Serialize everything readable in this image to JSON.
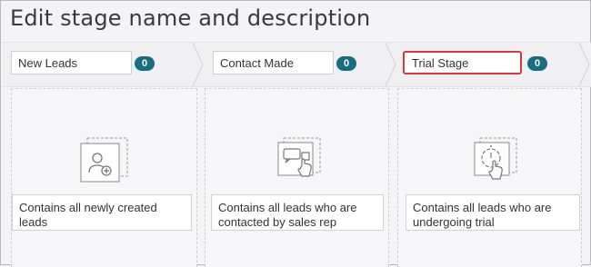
{
  "page": {
    "title": "Edit stage name and description"
  },
  "stages": [
    {
      "name": "New Leads",
      "count": "0",
      "description": "Contains all newly created leads",
      "icon": "add-user-icon"
    },
    {
      "name": "Contact Made",
      "count": "0",
      "description": "Contains all leads who are contacted by sales rep",
      "icon": "chat-touch-icon"
    },
    {
      "name": "Trial Stage",
      "count": "0",
      "description": "Contains all leads who are undergoing trial",
      "icon": "stopwatch-touch-icon"
    }
  ],
  "colors": {
    "badge": "#176e80",
    "highlight": "#d9363e"
  }
}
